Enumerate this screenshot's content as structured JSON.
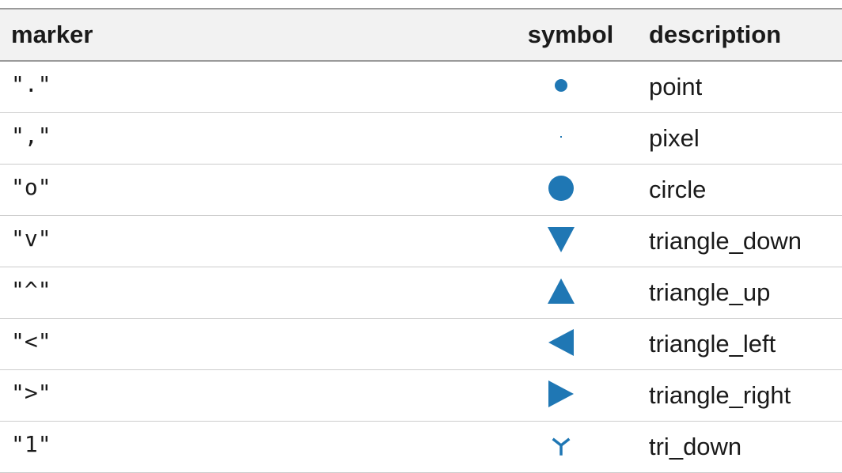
{
  "table": {
    "headers": {
      "marker": "marker",
      "symbol": "symbol",
      "description": "description"
    },
    "rows": [
      {
        "marker": "\".\"",
        "symbol": "point-icon",
        "description": "point"
      },
      {
        "marker": "\",\"",
        "symbol": "pixel-icon",
        "description": "pixel"
      },
      {
        "marker": "\"o\"",
        "symbol": "circle-icon",
        "description": "circle"
      },
      {
        "marker": "\"v\"",
        "symbol": "triangle-down-icon",
        "description": "triangle_down"
      },
      {
        "marker": "\"^\"",
        "symbol": "triangle-up-icon",
        "description": "triangle_up"
      },
      {
        "marker": "\"<\"",
        "symbol": "triangle-left-icon",
        "description": "triangle_left"
      },
      {
        "marker": "\">\"",
        "symbol": "triangle-right-icon",
        "description": "triangle_right"
      },
      {
        "marker": "\"1\"",
        "symbol": "tri-down-icon",
        "description": "tri_down"
      }
    ]
  },
  "colors": {
    "marker_fill": "#1f77b4",
    "header_background": "#f2f2f2",
    "rule": "#9a9a9a",
    "row_divider": "#cccccc"
  }
}
